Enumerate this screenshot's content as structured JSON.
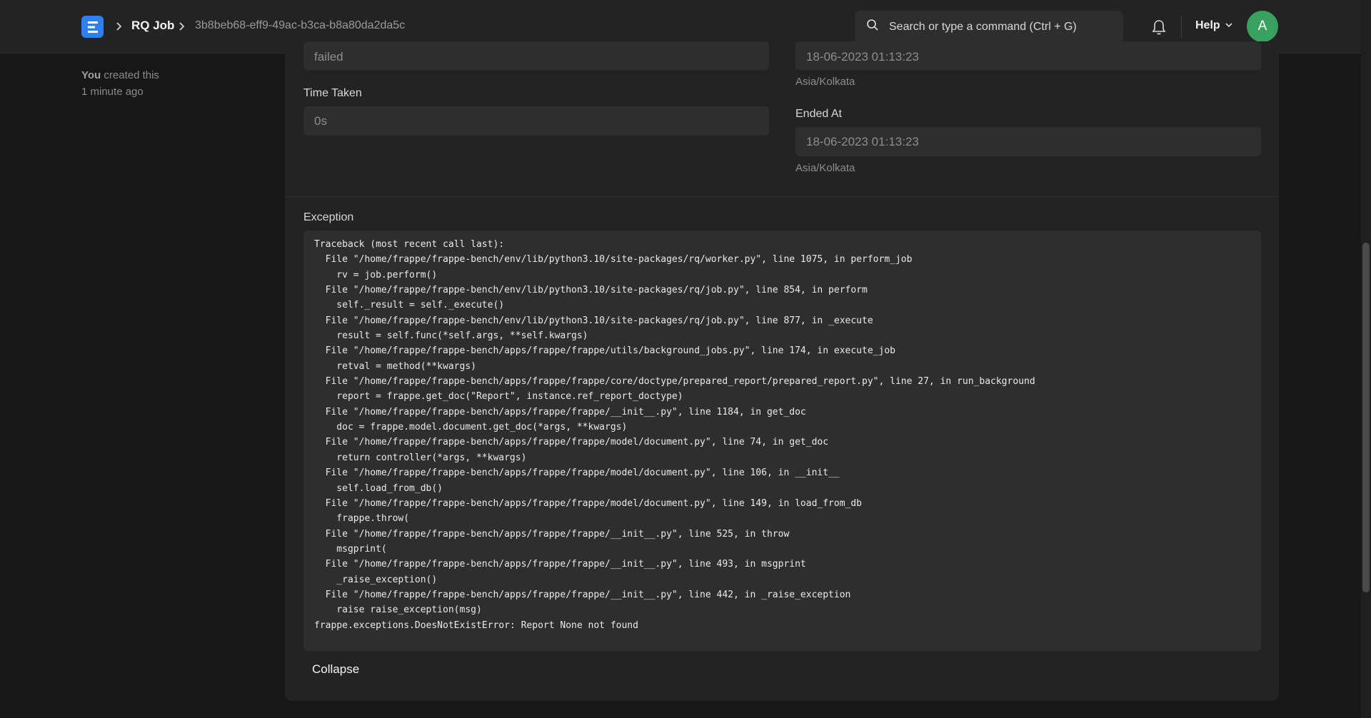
{
  "navbar": {
    "logo_letter": "E",
    "breadcrumb": {
      "doctype": "RQ Job",
      "current": "3b8beb68-eff9-49ac-b3ca-b8a80da2da5c"
    },
    "search_placeholder": "Search or type a command (Ctrl + G)",
    "help_label": "Help",
    "avatar_initial": "A",
    "avatar_color": "#38a160"
  },
  "sidebar": {
    "creator": "You",
    "created_text": "created this",
    "created_time": "1 minute ago"
  },
  "form": {
    "status_value": "failed",
    "started_at_value": "18-06-2023 01:13:23",
    "started_at_tz": "Asia/Kolkata",
    "time_taken_label": "Time Taken",
    "time_taken_value": "0s",
    "ended_at_label": "Ended At",
    "ended_at_value": "18-06-2023 01:13:23",
    "ended_at_tz": "Asia/Kolkata",
    "exception_label": "Exception",
    "exception_text": "Traceback (most recent call last):\n  File \"/home/frappe/frappe-bench/env/lib/python3.10/site-packages/rq/worker.py\", line 1075, in perform_job\n    rv = job.perform()\n  File \"/home/frappe/frappe-bench/env/lib/python3.10/site-packages/rq/job.py\", line 854, in perform\n    self._result = self._execute()\n  File \"/home/frappe/frappe-bench/env/lib/python3.10/site-packages/rq/job.py\", line 877, in _execute\n    result = self.func(*self.args, **self.kwargs)\n  File \"/home/frappe/frappe-bench/apps/frappe/frappe/utils/background_jobs.py\", line 174, in execute_job\n    retval = method(**kwargs)\n  File \"/home/frappe/frappe-bench/apps/frappe/frappe/core/doctype/prepared_report/prepared_report.py\", line 27, in run_background\n    report = frappe.get_doc(\"Report\", instance.ref_report_doctype)\n  File \"/home/frappe/frappe-bench/apps/frappe/frappe/__init__.py\", line 1184, in get_doc\n    doc = frappe.model.document.get_doc(*args, **kwargs)\n  File \"/home/frappe/frappe-bench/apps/frappe/frappe/model/document.py\", line 74, in get_doc\n    return controller(*args, **kwargs)\n  File \"/home/frappe/frappe-bench/apps/frappe/frappe/model/document.py\", line 106, in __init__\n    self.load_from_db()\n  File \"/home/frappe/frappe-bench/apps/frappe/frappe/model/document.py\", line 149, in load_from_db\n    frappe.throw(\n  File \"/home/frappe/frappe-bench/apps/frappe/frappe/__init__.py\", line 525, in throw\n    msgprint(\n  File \"/home/frappe/frappe-bench/apps/frappe/frappe/__init__.py\", line 493, in msgprint\n    _raise_exception()\n  File \"/home/frappe/frappe-bench/apps/frappe/frappe/__init__.py\", line 442, in _raise_exception\n    raise raise_exception(msg)\nfrappe.exceptions.DoesNotExistError: Report None not found",
    "collapse_label": "Collapse"
  },
  "icons": {
    "logo": "frappe-logo-icon",
    "breadcrumb_separator": "chevron-right-icon",
    "search": "search-icon",
    "notifications": "bell-icon",
    "help_dropdown": "chevron-down-icon"
  }
}
